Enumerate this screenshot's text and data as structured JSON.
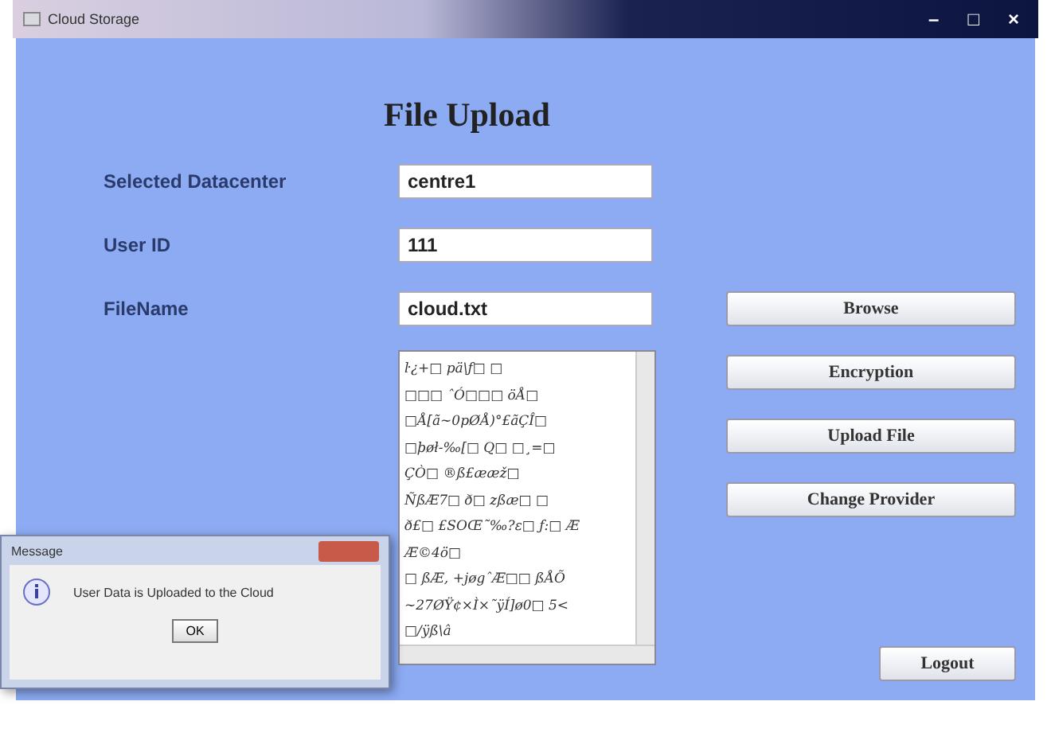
{
  "window": {
    "title": "Cloud Storage",
    "controls": [
      "–",
      "□",
      "×"
    ]
  },
  "heading": "File Upload",
  "fields": [
    {
      "label": "Selected Datacenter",
      "value": "centre1"
    },
    {
      "label": "User ID",
      "value": "111"
    },
    {
      "label": "FileName",
      "value": "cloud.txt"
    }
  ],
  "encrypted_text": [
    "ŀ¿+□ pä\\ƒ□ □",
    "□□□ ˆÓ□□□ öÅ□",
    "□Å[ã~0pØÅ)°£ãÇÎ□",
    "□þøł-‰[□ Q□ □¸=□",
    "ÇÒ□ ®ß£ææž□",
    "ÑßÆ7□ ð□ zßæ□ □",
    "ð£□ £SOŒ˜‰?ɛ□ ƒ:□ Æ",
    "Æ©4ö□",
    "□ ßÆ, +jøgˆÆ□□ ßÅÕ",
    "~27ØŸ¢×Ì×˜ÿÍ]ø0□ 5<",
    "□/ÿß\\â"
  ],
  "buttons": [
    "Browse",
    "Encryption",
    "Upload File",
    "Change Provider"
  ],
  "logout": "Logout",
  "dialog": {
    "title": "Message",
    "message": "User Data is Uploaded to the Cloud",
    "button": "OK"
  }
}
